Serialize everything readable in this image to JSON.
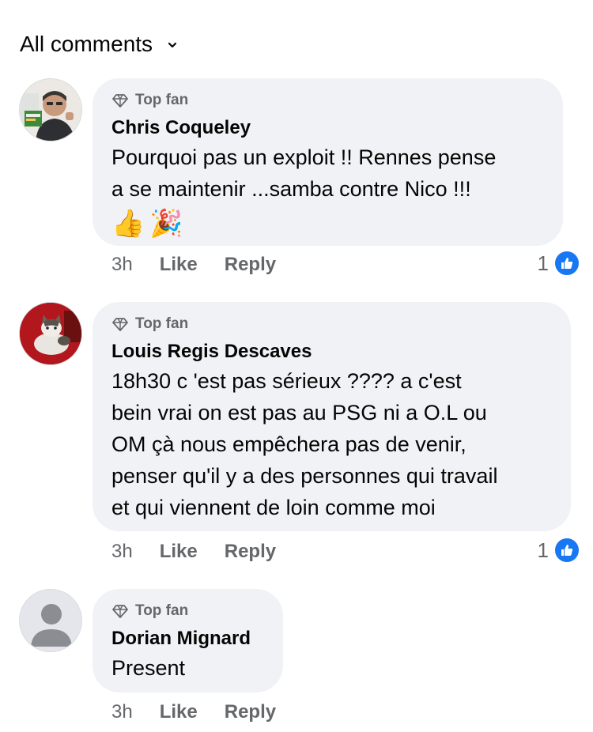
{
  "header": {
    "title": "All comments",
    "chevron_icon": "chevron-down-icon"
  },
  "comments": [
    {
      "badge": "Top fan",
      "author": "Chris Coqueley",
      "text": "Pourquoi pas un exploit !! Rennes pense\na se maintenir ...samba contre Nico !!!",
      "emojis": [
        "👍",
        "🎉"
      ],
      "time": "3h",
      "like": "Like",
      "reply": "Reply",
      "reaction_count": "1"
    },
    {
      "badge": "Top fan",
      "author": "Louis Regis Descaves",
      "text": "18h30 c 'est pas sérieux ???? a c'est\nbein vrai on est pas au PSG ni a O.L ou\nOM çà nous empêchera pas de venir,\npenser qu'il y a des personnes qui travail\net qui viennent de loin comme moi",
      "time": "3h",
      "like": "Like",
      "reply": "Reply",
      "reaction_count": "1"
    },
    {
      "badge": "Top fan",
      "author": "Dorian Mignard",
      "text": "Present",
      "time": "3h",
      "like": "Like",
      "reply": "Reply"
    }
  ],
  "colors": {
    "bubble": "#f0f2f5",
    "secondary_text": "#65676b",
    "like_blue": "#1877f2"
  }
}
